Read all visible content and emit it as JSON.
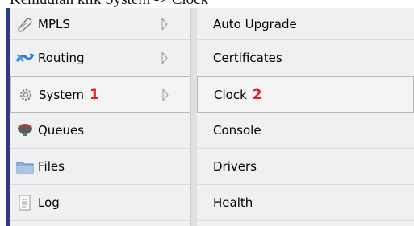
{
  "caption": "Kemudian klik System -> Clock",
  "menu": {
    "items": [
      {
        "label": "MPLS",
        "icon": "mpls-icon"
      },
      {
        "label": "Routing",
        "icon": "routing-icon"
      },
      {
        "label": "System",
        "icon": "system-gear-icon",
        "badge": "1"
      },
      {
        "label": "Queues",
        "icon": "queues-icon"
      },
      {
        "label": "Files",
        "icon": "folder-icon"
      },
      {
        "label": "Log",
        "icon": "log-icon"
      }
    ]
  },
  "submenu": {
    "items": [
      {
        "label": "Auto Upgrade"
      },
      {
        "label": "Certificates"
      },
      {
        "label": "Clock",
        "badge": "2"
      },
      {
        "label": "Console"
      },
      {
        "label": "Drivers"
      },
      {
        "label": "Health"
      }
    ]
  },
  "colors": {
    "badge": "#e0202a",
    "left_bar": "#2e3a8c",
    "menu_bg": "#f0f0f0"
  }
}
